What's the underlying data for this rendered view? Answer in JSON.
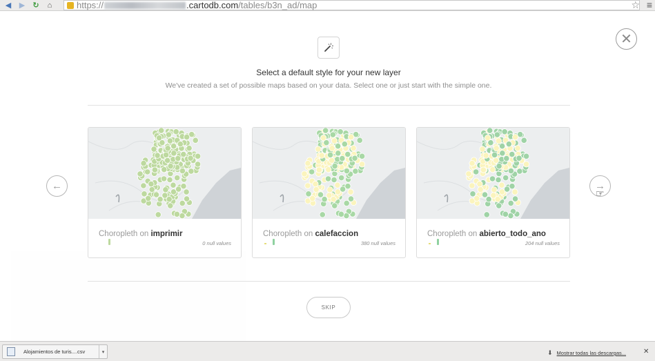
{
  "browser": {
    "back_icon": "back-arrow-icon",
    "forward_icon": "forward-arrow-icon",
    "reload_icon": "reload-icon",
    "home_icon": "home-icon",
    "url_protocol": "https://",
    "url_host": ".cartodb.com",
    "url_path": "/tables/b3n_ad/map",
    "star_icon": "bookmark-star-icon",
    "menu_icon": "menu-icon"
  },
  "modal": {
    "close_icon": "close-icon",
    "wand_icon": "magic-wand-icon",
    "title": "Select a default style for your new layer",
    "subtitle": "We've created a set of possible maps based on your data. Select one or just start with the simple one.",
    "prev_icon": "arrow-left-icon",
    "next_icon": "arrow-right-icon",
    "skip_label": "SKIP",
    "cards": [
      {
        "prefix": "Choropleth on ",
        "field": "imprimir",
        "nulls": "0 null values",
        "palette": [
          "#bdd99f"
        ]
      },
      {
        "prefix": "Choropleth on ",
        "field": "calefaccion",
        "nulls": "380 null values",
        "palette": [
          "#fbf4bd",
          "#a8d8a5"
        ]
      },
      {
        "prefix": "Choropleth on ",
        "field": "abierto_todo_ano",
        "nulls": "204 null values",
        "palette": [
          "#fbf4bd",
          "#9fd3a6"
        ]
      }
    ]
  },
  "downloads": {
    "file_icon": "csv-file-icon",
    "file_name": "Alojamientos de turis....csv",
    "caret_icon": "chevron-down-icon",
    "show_all_icon": "download-icon",
    "show_all_label": "Mostrar todas las descargas...",
    "close_icon": "close-icon"
  }
}
